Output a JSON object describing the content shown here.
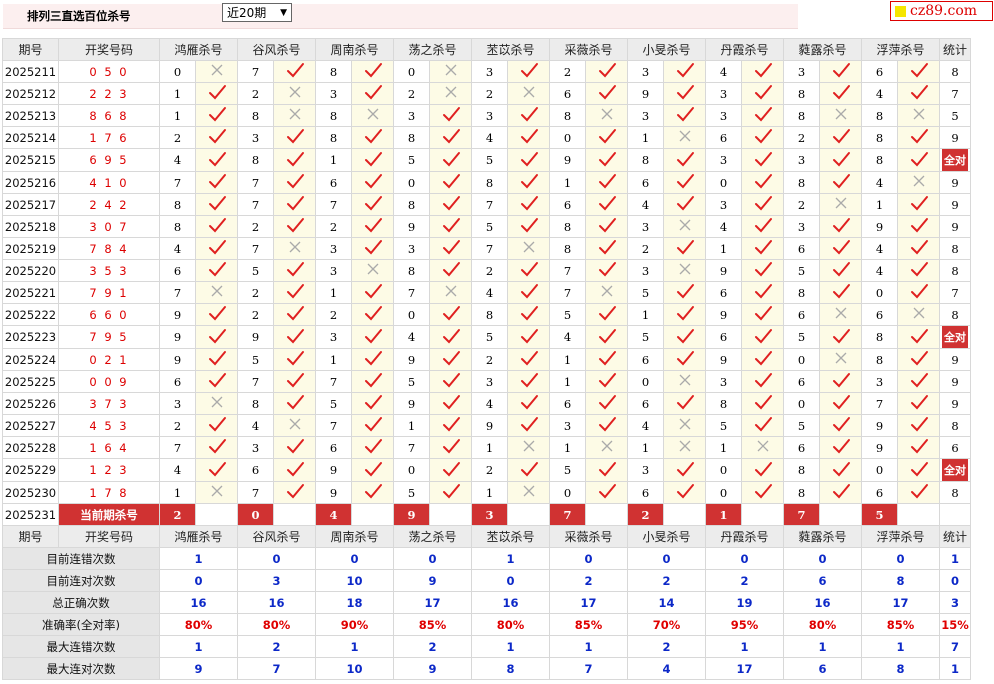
{
  "header": {
    "title": "排列三直选百位杀号",
    "period_select": "近20期",
    "logo": "cz89.com"
  },
  "columns": {
    "issue": "期号",
    "draw": "开奖号码",
    "count": "统计"
  },
  "experts": [
    "鸿雁杀号",
    "谷风杀号",
    "周南杀号",
    "荡之杀号",
    "苤苡杀号",
    "采薇杀号",
    "小旻杀号",
    "丹霞杀号",
    "蕤露杀号",
    "浮萍杀号"
  ],
  "rows": [
    {
      "issue": "2025211",
      "draw": "0 5 0",
      "kills": [
        "0",
        "7",
        "8",
        "0",
        "3",
        "2",
        "3",
        "4",
        "3",
        "6"
      ],
      "marks": [
        0,
        1,
        1,
        0,
        1,
        1,
        1,
        1,
        1,
        1
      ],
      "count": "8"
    },
    {
      "issue": "2025212",
      "draw": "2 2 3",
      "kills": [
        "1",
        "2",
        "3",
        "2",
        "2",
        "6",
        "9",
        "3",
        "8",
        "4"
      ],
      "marks": [
        1,
        0,
        1,
        0,
        0,
        1,
        1,
        1,
        1,
        1
      ],
      "count": "7"
    },
    {
      "issue": "2025213",
      "draw": "8 6 8",
      "kills": [
        "1",
        "8",
        "8",
        "3",
        "3",
        "8",
        "3",
        "3",
        "8",
        "8"
      ],
      "marks": [
        1,
        0,
        0,
        1,
        1,
        0,
        1,
        1,
        0,
        0
      ],
      "count": "5"
    },
    {
      "issue": "2025214",
      "draw": "1 7 6",
      "kills": [
        "2",
        "3",
        "8",
        "8",
        "4",
        "0",
        "1",
        "6",
        "2",
        "8"
      ],
      "marks": [
        1,
        1,
        1,
        1,
        1,
        1,
        0,
        1,
        1,
        1
      ],
      "count": "9"
    },
    {
      "issue": "2025215",
      "draw": "6 9 5",
      "kills": [
        "4",
        "8",
        "1",
        "5",
        "5",
        "9",
        "8",
        "3",
        "3",
        "8"
      ],
      "marks": [
        1,
        1,
        1,
        1,
        1,
        1,
        1,
        1,
        1,
        1
      ],
      "count": "全对"
    },
    {
      "issue": "2025216",
      "draw": "4 1 0",
      "kills": [
        "7",
        "7",
        "6",
        "0",
        "8",
        "1",
        "6",
        "0",
        "8",
        "4"
      ],
      "marks": [
        1,
        1,
        1,
        1,
        1,
        1,
        1,
        1,
        1,
        0
      ],
      "count": "9"
    },
    {
      "issue": "2025217",
      "draw": "2 4 2",
      "kills": [
        "8",
        "7",
        "7",
        "8",
        "7",
        "6",
        "4",
        "3",
        "2",
        "1"
      ],
      "marks": [
        1,
        1,
        1,
        1,
        1,
        1,
        1,
        1,
        0,
        1
      ],
      "count": "9"
    },
    {
      "issue": "2025218",
      "draw": "3 0 7",
      "kills": [
        "8",
        "2",
        "2",
        "9",
        "5",
        "8",
        "3",
        "4",
        "3",
        "9"
      ],
      "marks": [
        1,
        1,
        1,
        1,
        1,
        1,
        0,
        1,
        1,
        1
      ],
      "count": "9"
    },
    {
      "issue": "2025219",
      "draw": "7 8 4",
      "kills": [
        "4",
        "7",
        "3",
        "3",
        "7",
        "8",
        "2",
        "1",
        "6",
        "4"
      ],
      "marks": [
        1,
        0,
        1,
        1,
        0,
        1,
        1,
        1,
        1,
        1
      ],
      "count": "8"
    },
    {
      "issue": "2025220",
      "draw": "3 5 3",
      "kills": [
        "6",
        "5",
        "3",
        "8",
        "2",
        "7",
        "3",
        "9",
        "5",
        "4"
      ],
      "marks": [
        1,
        1,
        0,
        1,
        1,
        1,
        0,
        1,
        1,
        1
      ],
      "count": "8"
    },
    {
      "issue": "2025221",
      "draw": "7 9 1",
      "kills": [
        "7",
        "2",
        "1",
        "7",
        "4",
        "7",
        "5",
        "6",
        "8",
        "0"
      ],
      "marks": [
        0,
        1,
        1,
        0,
        1,
        0,
        1,
        1,
        1,
        1
      ],
      "count": "7"
    },
    {
      "issue": "2025222",
      "draw": "6 6 0",
      "kills": [
        "9",
        "2",
        "2",
        "0",
        "8",
        "5",
        "1",
        "9",
        "6",
        "6"
      ],
      "marks": [
        1,
        1,
        1,
        1,
        1,
        1,
        1,
        1,
        0,
        0
      ],
      "count": "8"
    },
    {
      "issue": "2025223",
      "draw": "7 9 5",
      "kills": [
        "9",
        "9",
        "3",
        "4",
        "5",
        "4",
        "5",
        "6",
        "5",
        "8"
      ],
      "marks": [
        1,
        1,
        1,
        1,
        1,
        1,
        1,
        1,
        1,
        1
      ],
      "count": "全对"
    },
    {
      "issue": "2025224",
      "draw": "0 2 1",
      "kills": [
        "9",
        "5",
        "1",
        "9",
        "2",
        "1",
        "6",
        "9",
        "0",
        "8"
      ],
      "marks": [
        1,
        1,
        1,
        1,
        1,
        1,
        1,
        1,
        0,
        1
      ],
      "count": "9"
    },
    {
      "issue": "2025225",
      "draw": "0 0 9",
      "kills": [
        "6",
        "7",
        "7",
        "5",
        "3",
        "1",
        "0",
        "3",
        "6",
        "3"
      ],
      "marks": [
        1,
        1,
        1,
        1,
        1,
        1,
        0,
        1,
        1,
        1
      ],
      "count": "9"
    },
    {
      "issue": "2025226",
      "draw": "3 7 3",
      "kills": [
        "3",
        "8",
        "5",
        "9",
        "4",
        "6",
        "6",
        "8",
        "0",
        "7"
      ],
      "marks": [
        0,
        1,
        1,
        1,
        1,
        1,
        1,
        1,
        1,
        1
      ],
      "count": "9"
    },
    {
      "issue": "2025227",
      "draw": "4 5 3",
      "kills": [
        "2",
        "4",
        "7",
        "1",
        "9",
        "3",
        "4",
        "5",
        "5",
        "9"
      ],
      "marks": [
        1,
        0,
        1,
        1,
        1,
        1,
        0,
        1,
        1,
        1
      ],
      "count": "8"
    },
    {
      "issue": "2025228",
      "draw": "1 6 4",
      "kills": [
        "7",
        "3",
        "6",
        "7",
        "1",
        "1",
        "1",
        "1",
        "6",
        "9"
      ],
      "marks": [
        1,
        1,
        1,
        1,
        0,
        0,
        0,
        0,
        1,
        1
      ],
      "count": "6"
    },
    {
      "issue": "2025229",
      "draw": "1 2 3",
      "kills": [
        "4",
        "6",
        "9",
        "0",
        "2",
        "5",
        "3",
        "0",
        "8",
        "0"
      ],
      "marks": [
        1,
        1,
        1,
        1,
        1,
        1,
        1,
        1,
        1,
        1
      ],
      "count": "全对"
    },
    {
      "issue": "2025230",
      "draw": "1 7 8",
      "kills": [
        "1",
        "7",
        "9",
        "5",
        "1",
        "0",
        "6",
        "0",
        "8",
        "6"
      ],
      "marks": [
        0,
        1,
        1,
        1,
        0,
        1,
        1,
        1,
        1,
        1
      ],
      "count": "8"
    }
  ],
  "current": {
    "issue": "2025231",
    "label": "当前期杀号",
    "kills": [
      "2",
      "0",
      "4",
      "9",
      "3",
      "7",
      "2",
      "1",
      "7",
      "5"
    ]
  },
  "stats": [
    {
      "label": "目前连错次数",
      "values": [
        "1",
        "0",
        "0",
        "0",
        "1",
        "0",
        "0",
        "0",
        "0",
        "0"
      ],
      "count": "1"
    },
    {
      "label": "目前连对次数",
      "values": [
        "0",
        "3",
        "10",
        "9",
        "0",
        "2",
        "2",
        "2",
        "6",
        "8"
      ],
      "count": "0"
    },
    {
      "label": "总正确次数",
      "values": [
        "16",
        "16",
        "18",
        "17",
        "16",
        "17",
        "14",
        "19",
        "16",
        "17"
      ],
      "count": "3"
    },
    {
      "label": "准确率(全对率)",
      "values": [
        "80%",
        "80%",
        "90%",
        "85%",
        "80%",
        "85%",
        "70%",
        "95%",
        "80%",
        "85%"
      ],
      "count": "15%"
    },
    {
      "label": "最大连错次数",
      "values": [
        "1",
        "2",
        "1",
        "2",
        "1",
        "1",
        "2",
        "1",
        "1",
        "1"
      ],
      "count": "7"
    },
    {
      "label": "最大连对次数",
      "values": [
        "9",
        "7",
        "10",
        "9",
        "8",
        "7",
        "4",
        "17",
        "6",
        "8"
      ],
      "count": "1"
    }
  ]
}
